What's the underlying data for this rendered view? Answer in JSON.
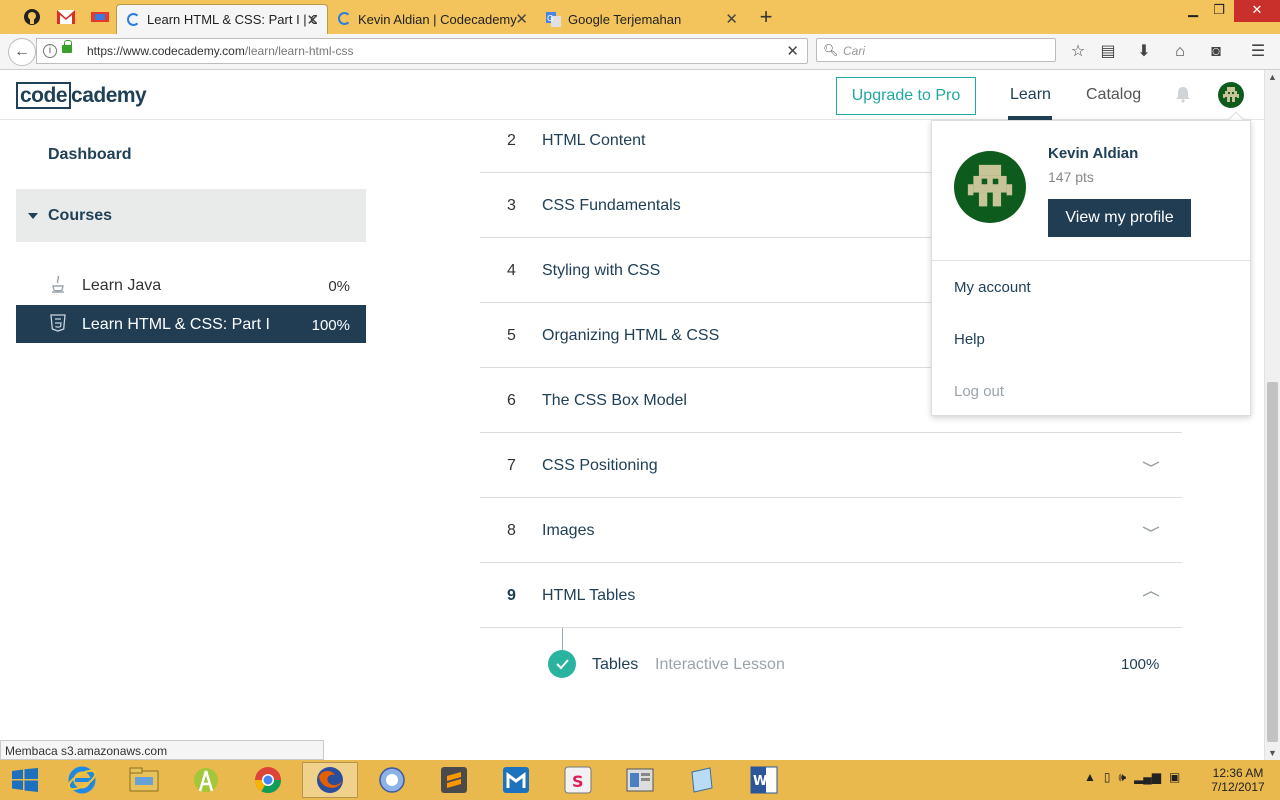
{
  "browser": {
    "tabs": [
      {
        "label": "Learn HTML & CSS: Part I | C",
        "active": true
      },
      {
        "label": "Kevin Aldian | Codecademy",
        "active": false
      },
      {
        "label": "Google Terjemahan",
        "active": false
      }
    ],
    "url_host": "https://www.codecademy.com",
    "url_path": "/learn/learn-html-css",
    "search_placeholder": "Cari",
    "status_text": "Membaca s3.amazonaws.com"
  },
  "header": {
    "logo_left": "code",
    "logo_right": "cademy",
    "upgrade_label": "Upgrade to Pro",
    "nav_learn": "Learn",
    "nav_catalog": "Catalog"
  },
  "sidebar": {
    "dashboard": "Dashboard",
    "courses_label": "Courses",
    "courses": [
      {
        "title": "Learn Java",
        "progress": "0%",
        "icon": "java-icon"
      },
      {
        "title": "Learn HTML & CSS: Part I",
        "progress": "100%",
        "icon": "html5-icon"
      }
    ]
  },
  "curriculum": {
    "units": [
      {
        "num": "2",
        "title": "HTML Content"
      },
      {
        "num": "3",
        "title": "CSS Fundamentals"
      },
      {
        "num": "4",
        "title": "Styling with CSS"
      },
      {
        "num": "5",
        "title": "Organizing HTML & CSS"
      },
      {
        "num": "6",
        "title": "The CSS Box Model"
      },
      {
        "num": "7",
        "title": "CSS Positioning"
      },
      {
        "num": "8",
        "title": "Images"
      },
      {
        "num": "9",
        "title": "HTML Tables"
      }
    ],
    "lesson": {
      "title": "Tables",
      "type": "Interactive Lesson",
      "progress": "100%"
    }
  },
  "profile_menu": {
    "name": "Kevin Aldian",
    "points": "147 pts",
    "view_profile": "View my profile",
    "my_account": "My account",
    "help": "Help",
    "logout": "Log out"
  },
  "taskbar": {
    "time": "12:36 AM",
    "date": "7/12/2017"
  },
  "colors": {
    "brand_navy": "#203d54",
    "accent_teal": "#22a8a3",
    "check_green": "#2ab39e",
    "browser_chrome": "#f3c45b",
    "taskbar": "#e9b94d"
  }
}
